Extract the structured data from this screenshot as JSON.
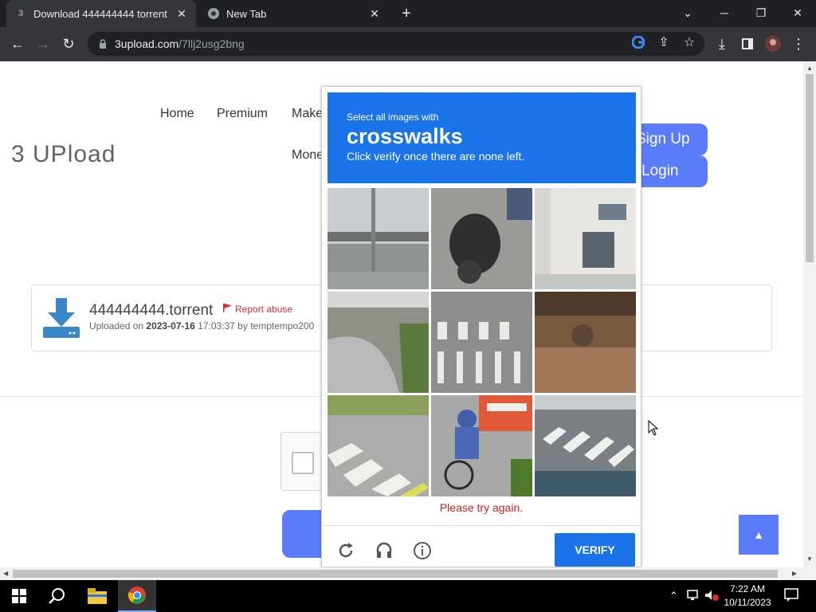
{
  "browser": {
    "tabs": [
      {
        "title": "Download 444444444 torrent",
        "favicon": "3"
      },
      {
        "title": "New Tab"
      }
    ],
    "url_domain": "3upload.com",
    "url_path": "/7llj2usg2bng"
  },
  "site": {
    "logo": "3 UPload",
    "nav": [
      "Home",
      "Premium",
      "Make",
      "Mone"
    ],
    "signup_label": "Sign Up",
    "login_label": "Login"
  },
  "file": {
    "name": "444444444.torrent",
    "report_label": "Report abuse",
    "uploaded_prefix": "Uploaded on",
    "upload_date": "2023-07-16",
    "upload_time": "17:03:37 by",
    "uploader": "temptempo200"
  },
  "challenge": {
    "instruction": "Select all images with",
    "target": "crosswalks",
    "subtext": "Click verify once there are none left.",
    "error": "Please try again.",
    "verify_label": "VERIFY",
    "tiles": [
      {
        "subject": "highway overpass"
      },
      {
        "subject": "motorcycle"
      },
      {
        "subject": "building with bicycle"
      },
      {
        "subject": "road curve with bollards"
      },
      {
        "subject": "crosswalk"
      },
      {
        "subject": "market stall"
      },
      {
        "subject": "crosswalk"
      },
      {
        "subject": "cyclists"
      },
      {
        "subject": "crosswalk"
      }
    ]
  },
  "taskbar": {
    "time": "7:22 AM",
    "date": "10/11/2023"
  },
  "colors": {
    "accent_blue": "#1a73e8",
    "site_blue": "#5b7cfa",
    "error_red": "#c5221f"
  }
}
